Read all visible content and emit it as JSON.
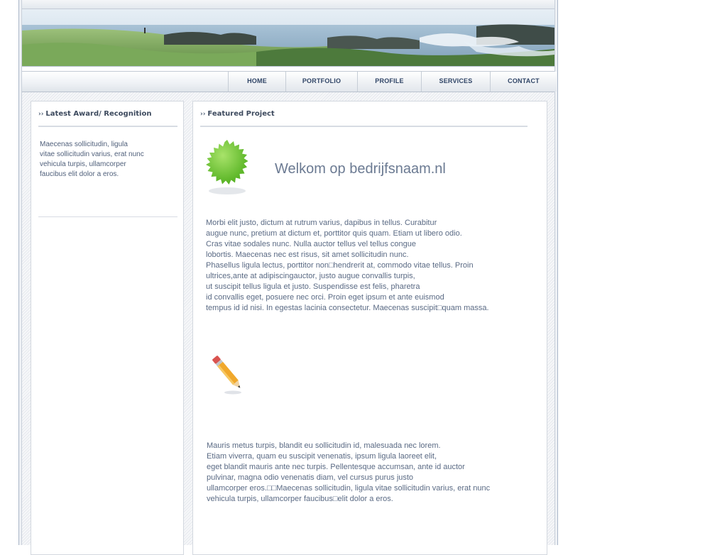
{
  "nav": {
    "items": [
      {
        "label": "HOME"
      },
      {
        "label": "PORTFOLIO"
      },
      {
        "label": "PROFILE"
      },
      {
        "label": "SERVICES"
      },
      {
        "label": "CONTACT"
      }
    ]
  },
  "sidebar": {
    "title": "Latest Award/ Recognition",
    "text": "Maecenas sollicitudin, ligula\nvitae sollicitudin varius, erat nunc\nvehicula turpis, ullamcorper\nfaucibus elit dolor a eros."
  },
  "main": {
    "title": "Featured Project",
    "welcome": "Welkom op bedrijfsnaam.nl",
    "paragraph1": "Morbi elit justo, dictum at rutrum varius, dapibus in tellus. Curabitur\naugue nunc, pretium at dictum et, porttitor quis quam. Etiam ut libero odio.\nCras vitae sodales nunc. Nulla auctor tellus vel tellus congue\nlobortis. Maecenas nec est risus, sit amet sollicitudin nunc.\nPhasellus ligula lectus, porttitor non□hendrerit at, commodo vitae tellus. Proin\nultrices,ante at adipiscingauctor, justo augue convallis turpis,\nut suscipit tellus ligula et justo. Suspendisse est felis, pharetra\nid convallis eget, posuere nec orci. Proin eget ipsum et ante euismod\ntempus id id nisi. In egestas lacinia consectetur. Maecenas suscipit□quam massa.",
    "paragraph2": "Mauris metus turpis, blandit eu sollicitudin id, malesuada nec lorem.\nEtiam viverra, quam eu suscipit venenatis, ipsum ligula laoreet elit,\neget blandit mauris ante nec turpis. Pellentesque accumsan, ante id auctor\npulvinar, magna odio venenatis diam, vel cursus purus justo\nullamcorper eros.□□Maecenas sollicitudin, ligula vitae sollicitudin varius, erat nunc\nvehicula turpis, ullamcorper faucibus□elit dolor a eros."
  },
  "icons": {
    "badge": "green-starburst-icon",
    "pencil": "pencil-icon",
    "arrows": "double-chevron-right-icon"
  },
  "colors": {
    "nav_text": "#2f4466",
    "body_text": "#5a6a84",
    "heading_text": "#6b7a92",
    "badge_green": "#6cc832"
  }
}
